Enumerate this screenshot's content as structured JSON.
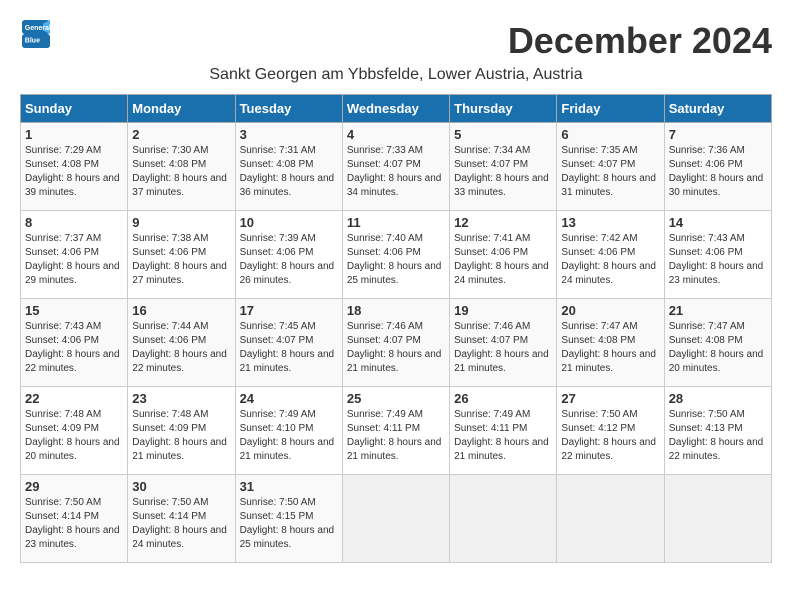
{
  "header": {
    "logo_general": "General",
    "logo_blue": "Blue",
    "month_title": "December 2024",
    "location": "Sankt Georgen am Ybbsfelde, Lower Austria, Austria"
  },
  "weekdays": [
    "Sunday",
    "Monday",
    "Tuesday",
    "Wednesday",
    "Thursday",
    "Friday",
    "Saturday"
  ],
  "weeks": [
    [
      {
        "day": "1",
        "sunrise": "7:29 AM",
        "sunset": "4:08 PM",
        "daylight": "8 hours and 39 minutes."
      },
      {
        "day": "2",
        "sunrise": "7:30 AM",
        "sunset": "4:08 PM",
        "daylight": "8 hours and 37 minutes."
      },
      {
        "day": "3",
        "sunrise": "7:31 AM",
        "sunset": "4:08 PM",
        "daylight": "8 hours and 36 minutes."
      },
      {
        "day": "4",
        "sunrise": "7:33 AM",
        "sunset": "4:07 PM",
        "daylight": "8 hours and 34 minutes."
      },
      {
        "day": "5",
        "sunrise": "7:34 AM",
        "sunset": "4:07 PM",
        "daylight": "8 hours and 33 minutes."
      },
      {
        "day": "6",
        "sunrise": "7:35 AM",
        "sunset": "4:07 PM",
        "daylight": "8 hours and 31 minutes."
      },
      {
        "day": "7",
        "sunrise": "7:36 AM",
        "sunset": "4:06 PM",
        "daylight": "8 hours and 30 minutes."
      }
    ],
    [
      {
        "day": "8",
        "sunrise": "7:37 AM",
        "sunset": "4:06 PM",
        "daylight": "8 hours and 29 minutes."
      },
      {
        "day": "9",
        "sunrise": "7:38 AM",
        "sunset": "4:06 PM",
        "daylight": "8 hours and 27 minutes."
      },
      {
        "day": "10",
        "sunrise": "7:39 AM",
        "sunset": "4:06 PM",
        "daylight": "8 hours and 26 minutes."
      },
      {
        "day": "11",
        "sunrise": "7:40 AM",
        "sunset": "4:06 PM",
        "daylight": "8 hours and 25 minutes."
      },
      {
        "day": "12",
        "sunrise": "7:41 AM",
        "sunset": "4:06 PM",
        "daylight": "8 hours and 24 minutes."
      },
      {
        "day": "13",
        "sunrise": "7:42 AM",
        "sunset": "4:06 PM",
        "daylight": "8 hours and 24 minutes."
      },
      {
        "day": "14",
        "sunrise": "7:43 AM",
        "sunset": "4:06 PM",
        "daylight": "8 hours and 23 minutes."
      }
    ],
    [
      {
        "day": "15",
        "sunrise": "7:43 AM",
        "sunset": "4:06 PM",
        "daylight": "8 hours and 22 minutes."
      },
      {
        "day": "16",
        "sunrise": "7:44 AM",
        "sunset": "4:06 PM",
        "daylight": "8 hours and 22 minutes."
      },
      {
        "day": "17",
        "sunrise": "7:45 AM",
        "sunset": "4:07 PM",
        "daylight": "8 hours and 21 minutes."
      },
      {
        "day": "18",
        "sunrise": "7:46 AM",
        "sunset": "4:07 PM",
        "daylight": "8 hours and 21 minutes."
      },
      {
        "day": "19",
        "sunrise": "7:46 AM",
        "sunset": "4:07 PM",
        "daylight": "8 hours and 21 minutes."
      },
      {
        "day": "20",
        "sunrise": "7:47 AM",
        "sunset": "4:08 PM",
        "daylight": "8 hours and 21 minutes."
      },
      {
        "day": "21",
        "sunrise": "7:47 AM",
        "sunset": "4:08 PM",
        "daylight": "8 hours and 20 minutes."
      }
    ],
    [
      {
        "day": "22",
        "sunrise": "7:48 AM",
        "sunset": "4:09 PM",
        "daylight": "8 hours and 20 minutes."
      },
      {
        "day": "23",
        "sunrise": "7:48 AM",
        "sunset": "4:09 PM",
        "daylight": "8 hours and 21 minutes."
      },
      {
        "day": "24",
        "sunrise": "7:49 AM",
        "sunset": "4:10 PM",
        "daylight": "8 hours and 21 minutes."
      },
      {
        "day": "25",
        "sunrise": "7:49 AM",
        "sunset": "4:11 PM",
        "daylight": "8 hours and 21 minutes."
      },
      {
        "day": "26",
        "sunrise": "7:49 AM",
        "sunset": "4:11 PM",
        "daylight": "8 hours and 21 minutes."
      },
      {
        "day": "27",
        "sunrise": "7:50 AM",
        "sunset": "4:12 PM",
        "daylight": "8 hours and 22 minutes."
      },
      {
        "day": "28",
        "sunrise": "7:50 AM",
        "sunset": "4:13 PM",
        "daylight": "8 hours and 22 minutes."
      }
    ],
    [
      {
        "day": "29",
        "sunrise": "7:50 AM",
        "sunset": "4:14 PM",
        "daylight": "8 hours and 23 minutes."
      },
      {
        "day": "30",
        "sunrise": "7:50 AM",
        "sunset": "4:14 PM",
        "daylight": "8 hours and 24 minutes."
      },
      {
        "day": "31",
        "sunrise": "7:50 AM",
        "sunset": "4:15 PM",
        "daylight": "8 hours and 25 minutes."
      },
      null,
      null,
      null,
      null
    ]
  ],
  "labels": {
    "sunrise": "Sunrise:",
    "sunset": "Sunset:",
    "daylight": "Daylight:"
  }
}
